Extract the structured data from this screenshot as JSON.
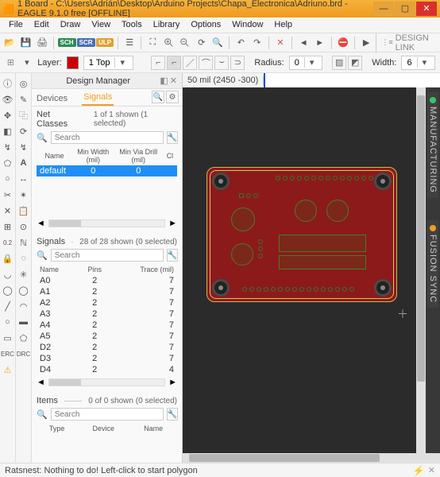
{
  "window": {
    "title": "1 Board - C:\\Users\\Adrián\\Desktop\\Arduino Projects\\Chapa_Electronica\\Adriuno.brd - EAGLE 9.1.0 free [OFFLINE]"
  },
  "menu": [
    "File",
    "Edit",
    "Draw",
    "View",
    "Tools",
    "Library",
    "Options",
    "Window",
    "Help"
  ],
  "toolbar": {
    "badge_sch": "SCH",
    "badge_scr": "SCR",
    "badge_ulp": "ULP",
    "design_link": "DESIGN LINK"
  },
  "layerbar": {
    "label_layer": "Layer:",
    "layer_name": "1 Top",
    "label_radius": "Radius:",
    "radius_value": "0",
    "label_width": "Width:",
    "width_value": "6"
  },
  "panel": {
    "title": "Design Manager"
  },
  "coord": {
    "scale": "50 mil (2450 -300)"
  },
  "tabs": {
    "devices": "Devices",
    "signals": "Signals"
  },
  "netclasses": {
    "title": "Net Classes",
    "count": "1 of 1 shown (1 selected)",
    "search_ph": "Search",
    "cols": {
      "name": "Name",
      "minw": "Min Width\n(mil)",
      "minv": "Min Via Drill\n(mil)",
      "cl": "Cl"
    },
    "row": {
      "name": "default",
      "minw": "0",
      "minv": "0"
    }
  },
  "signals": {
    "title": "Signals",
    "count": "28 of 28 shown (0 selected)",
    "search_ph": "Search",
    "cols": {
      "name": "Name",
      "pins": "Pins",
      "trace": "Trace (mil)"
    },
    "rows": [
      {
        "name": "A0",
        "pins": "2",
        "trace": "7"
      },
      {
        "name": "A1",
        "pins": "2",
        "trace": "7"
      },
      {
        "name": "A2",
        "pins": "2",
        "trace": "7"
      },
      {
        "name": "A3",
        "pins": "2",
        "trace": "7"
      },
      {
        "name": "A4",
        "pins": "2",
        "trace": "7"
      },
      {
        "name": "A5",
        "pins": "2",
        "trace": "7"
      },
      {
        "name": "D2",
        "pins": "2",
        "trace": "7"
      },
      {
        "name": "D3",
        "pins": "2",
        "trace": "7"
      },
      {
        "name": "D4",
        "pins": "2",
        "trace": "4"
      }
    ]
  },
  "items": {
    "title": "Items",
    "count": "0 of 0 shown (0 selected)",
    "search_ph": "Search",
    "cols": {
      "type": "Type",
      "device": "Device",
      "name": "Name"
    }
  },
  "rail": {
    "manu": "MANUFACTURING",
    "sync": "FUSION SYNC"
  },
  "lefttools": {
    "erc": "ERC",
    "drc": "DRC",
    "text": "A",
    "dim": "0.2"
  },
  "status": {
    "msg": "Ratsnest: Nothing to do! Left-click to start polygon"
  }
}
